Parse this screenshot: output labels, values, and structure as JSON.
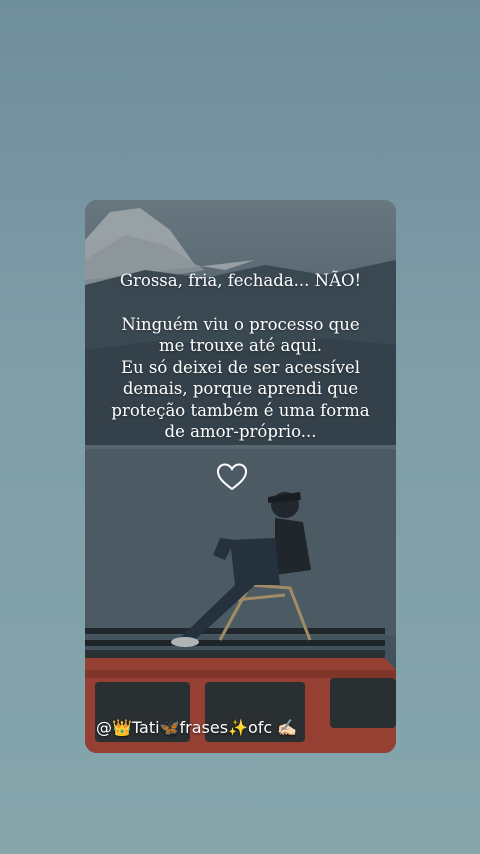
{
  "quote": {
    "line1": "Grossa, fria, fechada... NÃO!",
    "line2": "Ninguém viu o processo que",
    "line3": "me trouxe até aqui.",
    "line4": "Eu só deixei de ser acessível",
    "line5": "demais, porque aprendi que",
    "line6": "proteção também é uma forma",
    "line7": "de amor-próprio..."
  },
  "heart_icon": "heart-outline-icon",
  "handle": "@👑Tati🦋frases✨ofc ✍🏻",
  "colors": {
    "page_background": "#7b9aa5",
    "text": "#ffffff",
    "car_red": "#b8432e"
  }
}
